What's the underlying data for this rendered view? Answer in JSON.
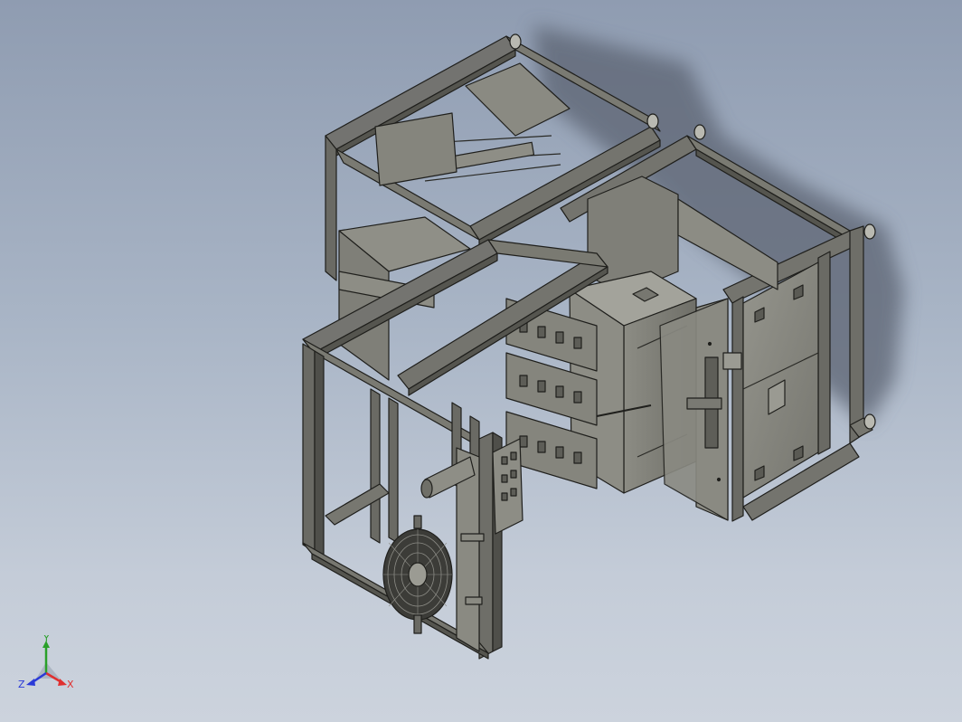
{
  "viewport": {
    "background_top": "#8f9cb1",
    "background_bottom": "#ccd3dd"
  },
  "model": {
    "frame_color": "#6e6e68",
    "frame_edge_color": "#1f1f1c",
    "panel_color": "#8a8a82",
    "shadow_color": "#5c6472"
  },
  "triad": {
    "x_label": "X",
    "y_label": "Y",
    "z_label": "Z",
    "x_color": "#e03030",
    "y_color": "#2aa02a",
    "z_color": "#2a3ad8"
  }
}
